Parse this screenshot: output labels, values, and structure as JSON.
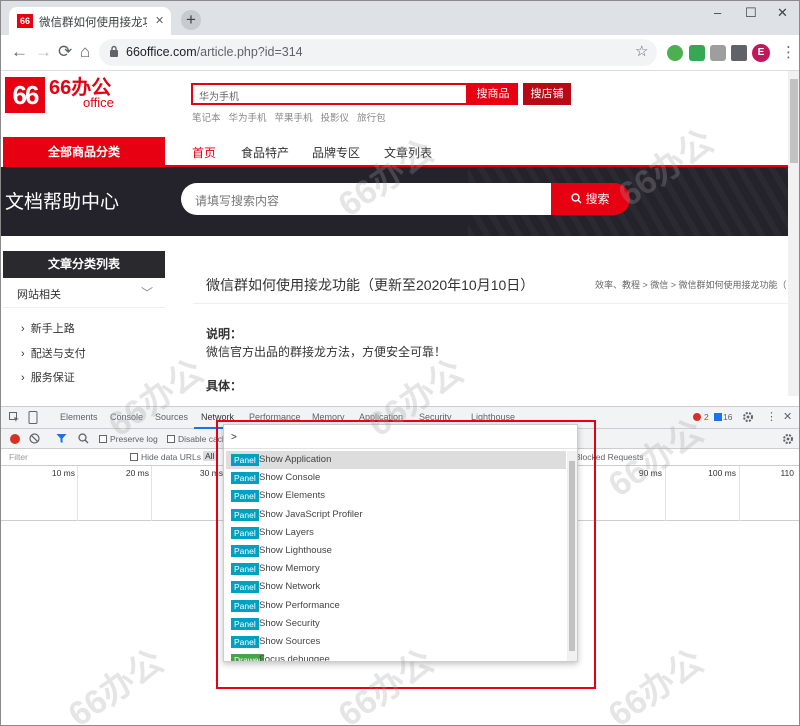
{
  "browser": {
    "tab_title": "微信群如何使用接龙功能（更新至",
    "tab_favicon": "66",
    "tab_close": "✕",
    "new_tab": "+",
    "win_min": "–",
    "win_max": "☐",
    "win_close": "✕",
    "back": "←",
    "forward": "→",
    "reload": "⟳",
    "home": "⌂",
    "url_host": "66office.com",
    "url_path": "/article.php?id=314",
    "bookmark": "☆",
    "profile_initial": "E",
    "menu": "⋮"
  },
  "site": {
    "logo_num": "66",
    "logo_text": "66办公",
    "logo_sub": "office",
    "search_placeholder": "华为手机",
    "search_goods": "搜商品",
    "search_shop": "搜店铺",
    "hotwords": [
      "笔记本",
      "华为手机",
      "苹果手机",
      "投影仪",
      "旅行包"
    ],
    "all_categories": "全部商品分类",
    "nav": [
      "首页",
      "食品特产",
      "品牌专区",
      "文章列表"
    ],
    "banner_title": "文档帮助中心",
    "banner_search_placeholder": "请填写搜索内容",
    "banner_search_btn": "搜索",
    "sidebar_head": "文章分类列表",
    "sidebar_group": "网站相关",
    "sidebar_chevron": "﹀",
    "sidebar_items": [
      "新手上路",
      "配送与支付",
      "服务保证"
    ],
    "sidebar_bullet": "›",
    "article_title": "微信群如何使用接龙功能（更新至2020年10月10日）",
    "breadcrumb": "效率、教程  >  微信  >  微信群如何使用接龙功能（",
    "section1_heading": "说明：",
    "section1_text": "微信官方出品的群接龙方法，方便安全可靠！",
    "section2_heading": "具体："
  },
  "devtools": {
    "tabs": [
      "Elements",
      "Console",
      "Sources",
      "Network",
      "Performance",
      "Memory",
      "Application",
      "Security",
      "Lighthouse"
    ],
    "active_tab": "Network",
    "errors": "2",
    "warnings": "16",
    "preserve_log": "Preserve log",
    "disable_cache": "Disable cach",
    "filter_placeholder": "Filter",
    "hide_data_urls": "Hide data URLs",
    "all": "All",
    "blocked_requests": "Blocked Requests",
    "ticks": [
      "10 ms",
      "20 ms",
      "30 ms",
      "90 ms",
      "100 ms",
      "110"
    ],
    "command_prompt": ">",
    "commands": [
      {
        "badge": "Panel",
        "label": "Show Application"
      },
      {
        "badge": "Panel",
        "label": "Show Console"
      },
      {
        "badge": "Panel",
        "label": "Show Elements"
      },
      {
        "badge": "Panel",
        "label": "Show JavaScript Profiler"
      },
      {
        "badge": "Panel",
        "label": "Show Layers"
      },
      {
        "badge": "Panel",
        "label": "Show Lighthouse"
      },
      {
        "badge": "Panel",
        "label": "Show Memory"
      },
      {
        "badge": "Panel",
        "label": "Show Network"
      },
      {
        "badge": "Panel",
        "label": "Show Performance"
      },
      {
        "badge": "Panel",
        "label": "Show Security"
      },
      {
        "badge": "Panel",
        "label": "Show Sources"
      },
      {
        "badge": "Drawer",
        "label": "Focus debuggee"
      }
    ]
  },
  "watermark": "66办公",
  "colors": {
    "brand_red": "#e60012",
    "panel_badge": "#00a1c0",
    "drawer_badge": "#47a447",
    "devtools_blue": "#1a73e8"
  }
}
